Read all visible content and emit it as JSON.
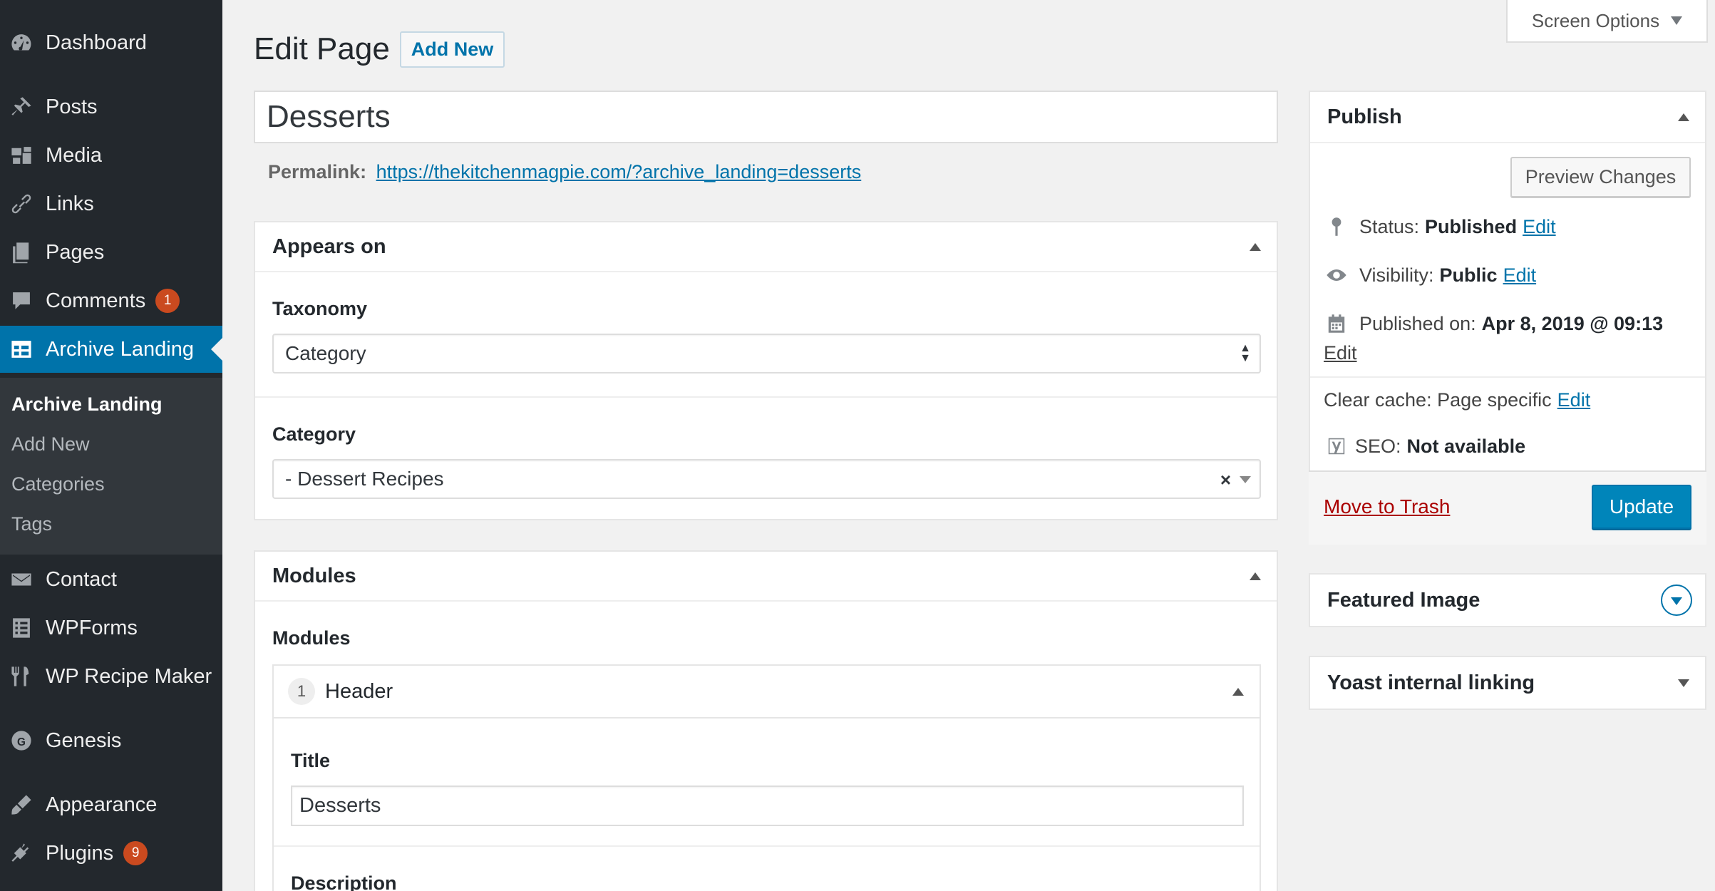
{
  "sidebar": {
    "items": [
      {
        "label": "Dashboard",
        "icon": "dashboard-icon"
      },
      {
        "label": "Posts",
        "icon": "pin-icon"
      },
      {
        "label": "Media",
        "icon": "media-icon"
      },
      {
        "label": "Links",
        "icon": "link-icon"
      },
      {
        "label": "Pages",
        "icon": "pages-icon"
      },
      {
        "label": "Comments",
        "icon": "comment-icon",
        "badge": "1"
      },
      {
        "label": "Archive Landing",
        "icon": "table-icon"
      },
      {
        "label": "Contact",
        "icon": "mail-icon"
      },
      {
        "label": "WPForms",
        "icon": "form-icon"
      },
      {
        "label": "WP Recipe Maker",
        "icon": "fork-knife-icon"
      },
      {
        "label": "Genesis",
        "icon": "genesis-icon"
      },
      {
        "label": "Appearance",
        "icon": "brush-icon"
      },
      {
        "label": "Plugins",
        "icon": "plugin-icon",
        "badge": "9"
      }
    ],
    "submenu": [
      "Archive Landing",
      "Add New",
      "Categories",
      "Tags"
    ],
    "colors": {
      "background": "#23282d",
      "active": "#0073aa",
      "submenu_bg": "#32373c",
      "badge": "#ca4a1f"
    }
  },
  "header": {
    "title": "Edit Page",
    "add_new": "Add New",
    "screen_options": "Screen Options"
  },
  "post": {
    "title": "Desserts",
    "permalink_label": "Permalink:",
    "permalink_url": "https://thekitchenmagpie.com/?archive_landing=desserts"
  },
  "appears_on": {
    "heading": "Appears on",
    "taxonomy_label": "Taxonomy",
    "taxonomy_value": "Category",
    "category_label": "Category",
    "category_value": "- Dessert Recipes",
    "clear_symbol": "×"
  },
  "modules": {
    "heading": "Modules",
    "field_label": "Modules",
    "item": {
      "number": "1",
      "name": "Header",
      "title_label": "Title",
      "title_value": "Desserts",
      "description_label": "Description"
    }
  },
  "publish": {
    "heading": "Publish",
    "preview_button": "Preview Changes",
    "status_label": "Status:",
    "status_value": "Published",
    "visibility_label": "Visibility:",
    "visibility_value": "Public",
    "published_label": "Published on:",
    "published_value": "Apr 8, 2019 @ 09:13",
    "edit_link": "Edit",
    "cache_label": "Clear cache: Page specific",
    "seo_label": "SEO:",
    "seo_value": "Not available",
    "trash_link": "Move to Trash",
    "update_button": "Update",
    "colors": {
      "primary": "#0085ba",
      "trash": "#aa0000"
    }
  },
  "featured_image": {
    "heading": "Featured Image"
  },
  "yoast_linking": {
    "heading": "Yoast internal linking"
  }
}
